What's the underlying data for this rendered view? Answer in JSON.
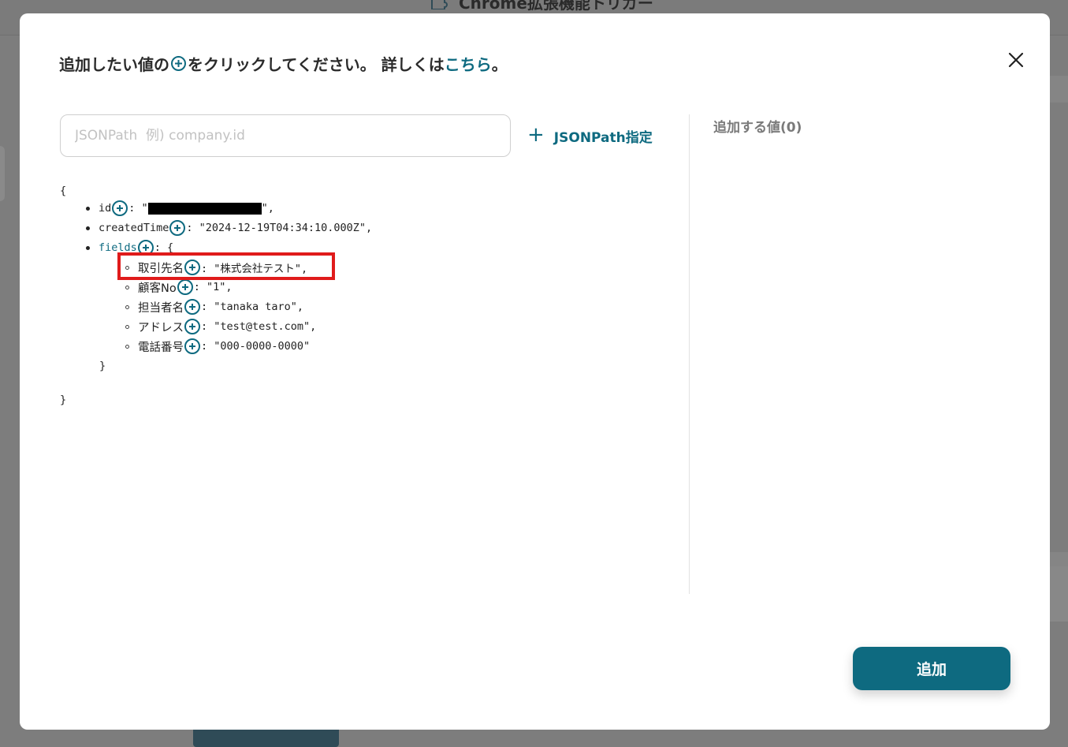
{
  "background": {
    "title": "Chrome拡張機能トリガー"
  },
  "modal": {
    "instruction_prefix": "追加したい値の",
    "instruction_middle": "をクリックしてください。 詳しくは",
    "instruction_link": "こちら",
    "instruction_suffix": "。",
    "search": {
      "placeholder": "JSONPath  例) company.id",
      "value": ""
    },
    "jsonpath_button_label": "JSONPath指定",
    "added_values_title": "追加する値(0)",
    "add_button_label": "追加"
  },
  "json": {
    "open_brace": "{",
    "close_brace": "}",
    "entries": [
      {
        "key": "id",
        "value": "\"",
        "value_suffix": "\","
      },
      {
        "key": "createdTime",
        "value": ": \"2024-12-19T04:34:10.000Z\","
      },
      {
        "key": "fields",
        "value": ": {"
      }
    ],
    "fields": [
      {
        "key": "取引先名",
        "value": ": \"株式会社テスト\","
      },
      {
        "key": "顧客No",
        "value": ": \"1\","
      },
      {
        "key": "担当者名",
        "value": ": \"tanaka taro\","
      },
      {
        "key": "アドレス",
        "value": ": \"test@test.com\","
      },
      {
        "key": "電話番号",
        "value": ": \"000-0000-0000\""
      }
    ],
    "fields_close": "}"
  },
  "colors": {
    "accent": "#0e6a80",
    "highlight": "#e01b1b",
    "overlay": "#7f7f7f"
  },
  "icons": [
    "puzzle-icon",
    "plus-circle-icon",
    "close-icon",
    "plus-icon"
  ]
}
